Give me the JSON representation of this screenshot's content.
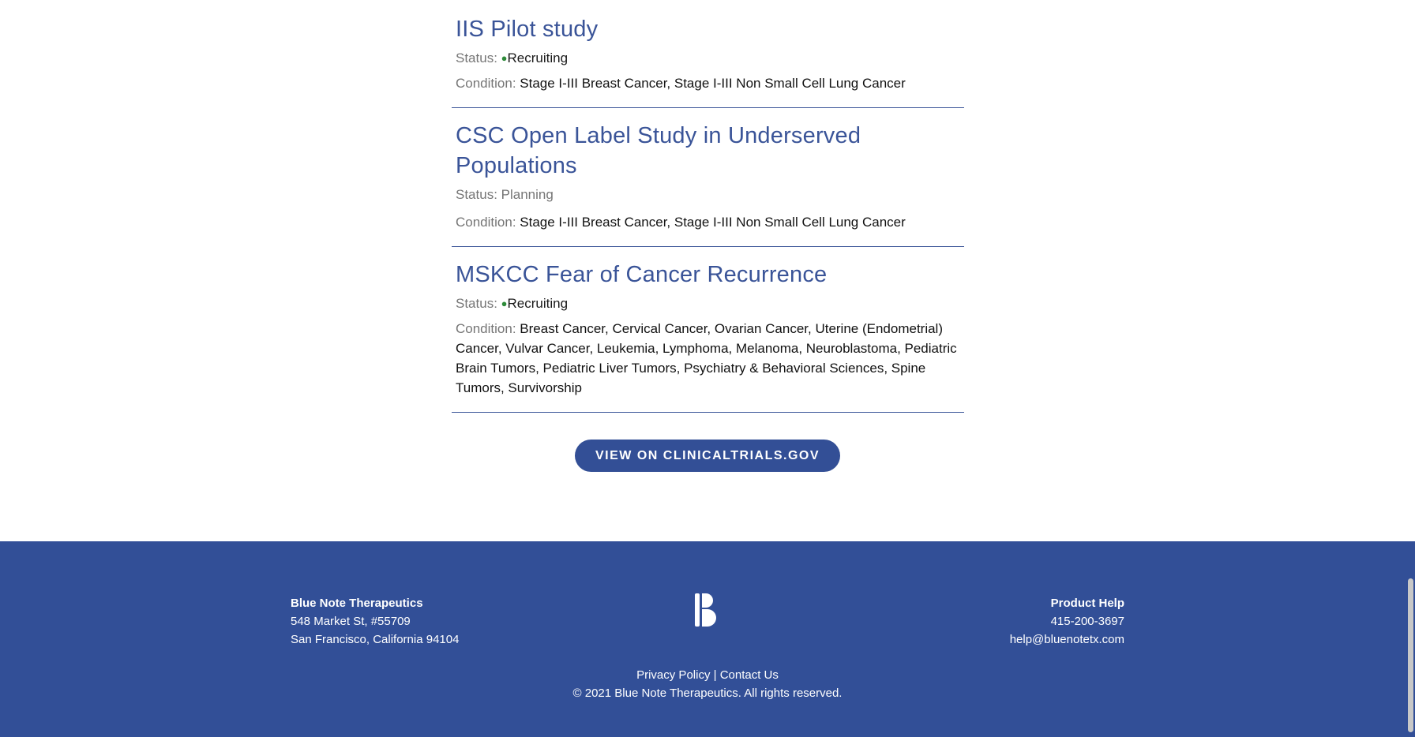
{
  "studies": [
    {
      "title": "IIS Pilot study",
      "status_label": "Status: ",
      "status_indicator": "●",
      "status_value": "Recruiting",
      "condition_label": "Condition: ",
      "condition_value": "Stage I-III Breast Cancer, Stage I-III Non Small Cell Lung Cancer"
    },
    {
      "title": "CSC Open Label Study in Underserved Populations",
      "status_label": "Status: ",
      "status_value": "Planning",
      "condition_label": "Condition: ",
      "condition_value": "Stage I-III Breast Cancer, Stage I-III Non Small Cell Lung Cancer"
    },
    {
      "title": "MSKCC Fear of Cancer Recurrence",
      "status_label": "Status: ",
      "status_indicator": "●",
      "status_value": "Recruiting",
      "condition_label": "Condition: ",
      "condition_value": "Breast Cancer, Cervical Cancer, Ovarian Cancer, Uterine (Endometrial) Cancer, Vulvar Cancer, Leukemia, Lymphoma, Melanoma, Neuroblastoma, Pediatric Brain Tumors, Pediatric Liver Tumors, Psychiatry & Behavioral Sciences, Spine Tumors, Survivorship"
    }
  ],
  "cta": {
    "label": "VIEW ON CLINICALTRIALS.GOV"
  },
  "footer": {
    "left": {
      "company": "Blue Note Therapeutics",
      "address_line1": "548 Market St, #55709",
      "address_line2": "San Francisco, California 94104"
    },
    "logo_icon": "blue-note-logo-icon",
    "right": {
      "heading": "Product Help",
      "phone": "415-200-3697",
      "email": "help@bluenotetx.com"
    },
    "privacy_label": "Privacy Policy",
    "separator": " | ",
    "contact_label": "Contact Us",
    "copyright": "© 2021 Blue Note Therapeutics. All rights reserved."
  },
  "colors": {
    "brand_blue": "#324f97",
    "recruiting_green": "#2e8b3a"
  }
}
